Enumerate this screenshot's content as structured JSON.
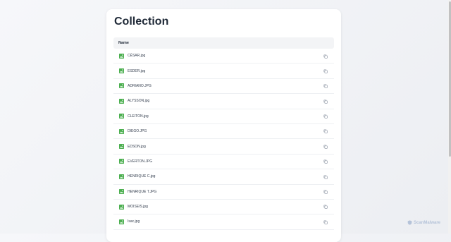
{
  "page": {
    "title": "Collection"
  },
  "table": {
    "header": "Name",
    "rows": [
      {
        "name": "CÉSAR.jpg"
      },
      {
        "name": "ESDER.jpg"
      },
      {
        "name": "ADRIANO.JPG"
      },
      {
        "name": "ALYSSON.jpg"
      },
      {
        "name": "CLEITON.jpg"
      },
      {
        "name": "DIEGO.JPG"
      },
      {
        "name": "EDSON.jpg"
      },
      {
        "name": "EVERTON.JPG"
      },
      {
        "name": "HENRIQUE C.jpg"
      },
      {
        "name": "HENRIQUE T.JPG"
      },
      {
        "name": "MOISEIS.jpg"
      },
      {
        "name": "Isac.jpg"
      }
    ]
  },
  "icons": {
    "file": "image-file-icon",
    "copy": "copy-icon"
  },
  "colors": {
    "file_icon": "#4caf50",
    "copy_icon": "#9ca3af",
    "title": "#1f2937"
  },
  "watermark": {
    "text": "ScanMalware"
  }
}
